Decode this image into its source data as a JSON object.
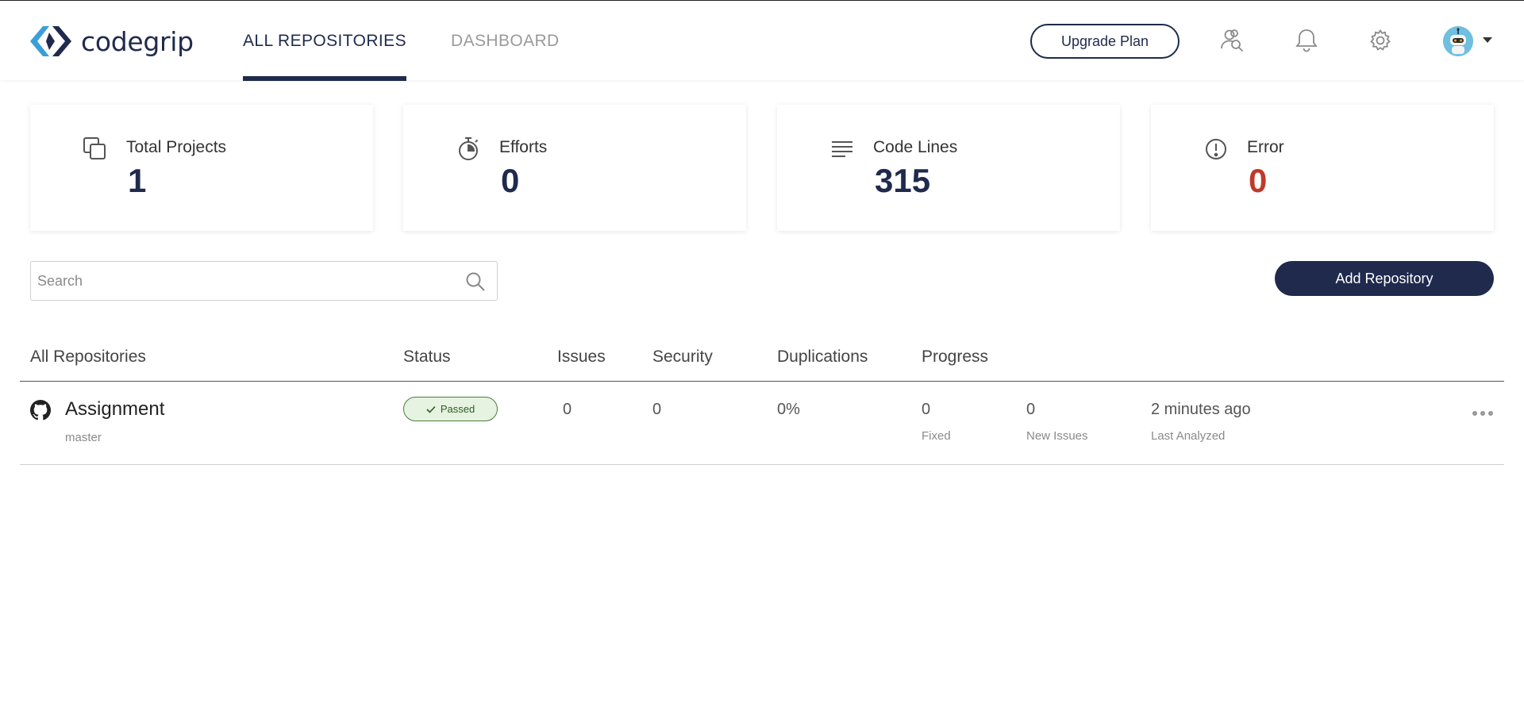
{
  "brand": {
    "name": "codegrip"
  },
  "nav": {
    "tabs": [
      {
        "label": "ALL REPOSITORIES",
        "active": true
      },
      {
        "label": "DASHBOARD",
        "active": false
      }
    ]
  },
  "header": {
    "upgrade_label": "Upgrade Plan",
    "icons": [
      "users-search-icon",
      "bell-icon",
      "gear-icon"
    ]
  },
  "stats": [
    {
      "label": "Total Projects",
      "value": "1",
      "icon": "layers-icon"
    },
    {
      "label": "Efforts",
      "value": "0",
      "icon": "stopwatch-icon"
    },
    {
      "label": "Code Lines",
      "value": "315",
      "icon": "lines-icon"
    },
    {
      "label": "Error",
      "value": "0",
      "icon": "alert-circle-icon"
    }
  ],
  "search": {
    "placeholder": "Search",
    "value": ""
  },
  "actions": {
    "add_repository": "Add Repository"
  },
  "table": {
    "headers": [
      "All Repositories",
      "Status",
      "Issues",
      "Security",
      "Duplications",
      "Progress"
    ],
    "rows": [
      {
        "name": "Assignment",
        "branch": "master",
        "status": "Passed",
        "issues": "0",
        "security": "0",
        "duplications": "0%",
        "fixed": "0",
        "fixed_label": "Fixed",
        "new_issues": "0",
        "new_issues_label": "New Issues",
        "last_analyzed": "2 minutes ago",
        "last_analyzed_label": "Last Analyzed"
      }
    ]
  },
  "colors": {
    "primary": "#1f2a4d",
    "error": "#c0392b",
    "passed_bg": "#e6f3e0",
    "logo_blue": "#3a9fd8"
  }
}
